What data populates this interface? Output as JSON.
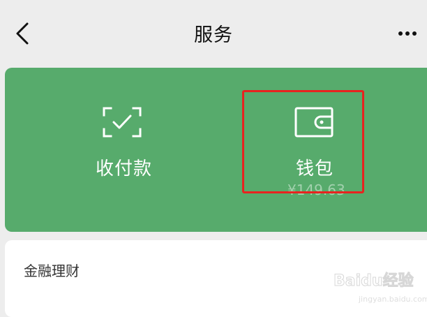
{
  "header": {
    "title": "服务"
  },
  "services": {
    "pay": {
      "label": "收付款"
    },
    "wallet": {
      "label": "钱包",
      "balance": "¥149.63"
    }
  },
  "sections": {
    "finance": {
      "title": "金融理财"
    }
  },
  "watermark": {
    "brand": "Baidu经验",
    "sub": "jingyan.baidu.com"
  },
  "colors": {
    "card_green": "#57ab6c",
    "highlight_red": "#e8231f",
    "background": "#ededed"
  },
  "icons": {
    "back": "chevron-left-icon",
    "more": "more-horizontal-icon",
    "pay": "scan-check-icon",
    "wallet": "wallet-icon"
  }
}
